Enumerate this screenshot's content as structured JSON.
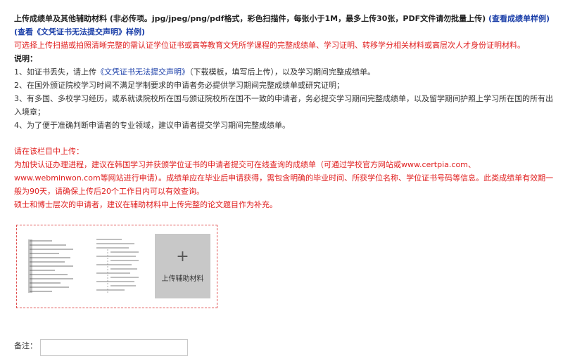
{
  "header": {
    "title": "上传成绩单及其他辅助材料 (非必传项。jpg/jpeg/png/pdf格式，彩色扫描件，每张小于1M，最多上传30张，PDF文件请勿批量上传)",
    "view_sample_link": "(查看成绩单样例)",
    "statement_sample_link": "(查看《文凭证书无法提交声明》样例)"
  },
  "notice_red": "可选择上传扫描或拍照清晰完整的需认证学位证书或高等教育文凭所学课程的完整成绩单、学习证明、转移学分相关材料或高层次人才身份证明材料。",
  "explanation": {
    "label": "说明：",
    "item1_prefix": "1、如证书丢失，请上传",
    "item1_link": "《文凭证书无法提交声明》",
    "item1_suffix": "（下载模板，填写后上传），以及学习期间完整成绩单。",
    "item2": "2、在国外颁证院校学习时间不满足学制要求的申请者务必提供学习期间完整成绩单或研究证明；",
    "item3": "3、有多国、多校学习经历，或系就读院校所在国与颁证院校所在国不一致的申请者，务必提交学习期间完整成绩单，以及留学期间护照上学习所在国的所有出入境章；",
    "item4": "4、为了便于准确判断申请者的专业领域，建议申请者提交学习期间完整成绩单。"
  },
  "red_section": {
    "line1": "请在该栏目中上传：",
    "line2": "为加快认证办理进程，建议在韩国学习并获颁学位证书的申请者提交可在线查询的成绩单（可通过学校官方网站或www.certpia.com、www.webminwon.com等网站进行申请）。成绩单应在毕业后申请获得，需包含明确的毕业时间、所获学位名称、学位证书号码等信息。此类成绩单有效期一般为90天，请确保上传后20个工作日内可以有效查询。",
    "line3": "硕士和博士层次的申请者，建议在辅助材料中上传完整的论文题目作为补充。"
  },
  "upload": {
    "plus": "+",
    "add_label": "上传辅助材料"
  },
  "remark": {
    "label": "备注：",
    "value": ""
  }
}
